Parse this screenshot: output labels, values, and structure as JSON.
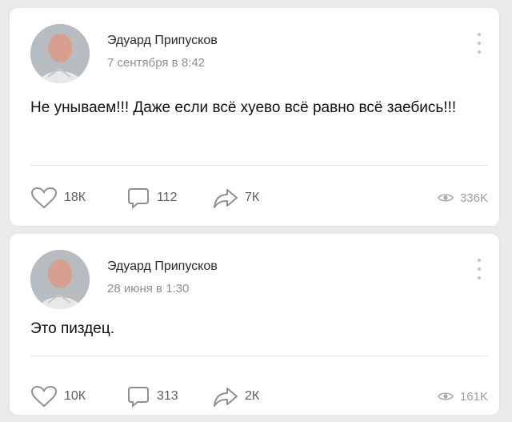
{
  "posts": [
    {
      "author": "Эдуард Припусков",
      "date": "7 сентября в 8:42",
      "text": "Не унываем!!! Даже если всё хуево всё равно всё заебись!!!",
      "likes": "18К",
      "comments": "112",
      "reposts": "7К",
      "views": "336K"
    },
    {
      "author": "Эдуард Припусков",
      "date": "28 июня в 1:30",
      "text": "Это пиздец.",
      "likes": "10К",
      "comments": "313",
      "reposts": "2К",
      "views": "161K"
    }
  ],
  "icons": {
    "like": "heart-icon",
    "comment": "comment-icon",
    "repost": "share-icon",
    "views": "eye-icon",
    "more": "more-vertical-icon"
  }
}
